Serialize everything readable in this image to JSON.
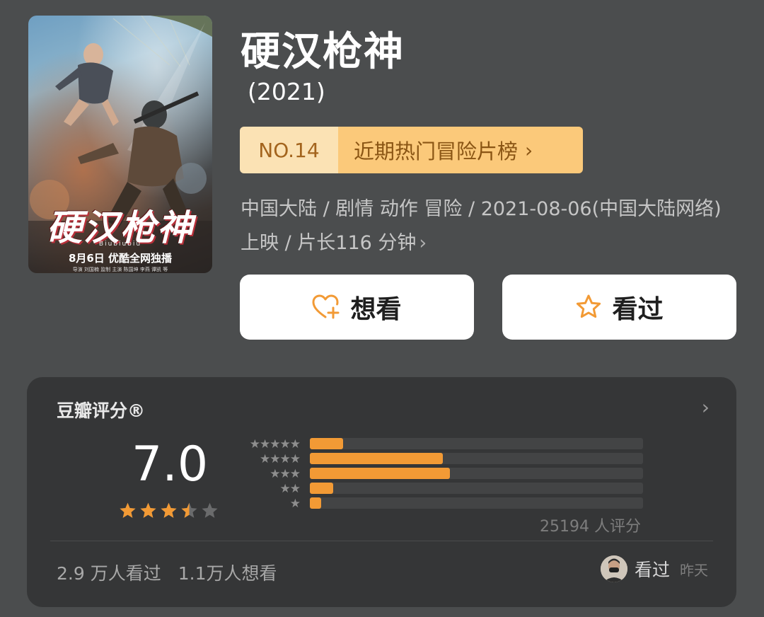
{
  "poster": {
    "title": "硬汉枪神",
    "subtitle": "Biubiubiu",
    "release_text": "8月6日 优酷全网独播",
    "credits": "导演 刘国楠 监制 主演 陈国坤 李燕 谭凯 等"
  },
  "movie": {
    "title": "硬汉枪神",
    "year": "(2021)"
  },
  "rank": {
    "number": "NO.14",
    "list_name": "近期热门冒险片榜",
    "chevron": "›"
  },
  "meta": {
    "text": "中国大陆 / 剧情 动作 冒险 / 2021-08-06(中国大陆网络) 上映 / 片长116 分钟",
    "chevron": "›"
  },
  "actions": {
    "want_label": "想看",
    "want_icon": "heart-plus-icon",
    "seen_label": "看过",
    "seen_icon": "star-outline-icon",
    "icon_color": "#f29a35"
  },
  "rating": {
    "title": "豆瓣评分®",
    "chevron": "›",
    "score": "7.0",
    "stars": 3.5,
    "distribution": [
      {
        "stars": "★★★★★",
        "fraction": 0.1
      },
      {
        "stars": "★★★★",
        "fraction": 0.4
      },
      {
        "stars": "★★★",
        "fraction": 0.42
      },
      {
        "stars": "★★",
        "fraction": 0.07
      },
      {
        "stars": "★",
        "fraction": 0.035
      }
    ],
    "count_text": "25194 人评分",
    "bar_color": "#f29a35",
    "star_color": "#f29a35"
  },
  "stats": {
    "seen": "2.9 万人看过",
    "want": "1.1万人想看"
  },
  "friend": {
    "action": "看过",
    "time": "昨天"
  }
}
